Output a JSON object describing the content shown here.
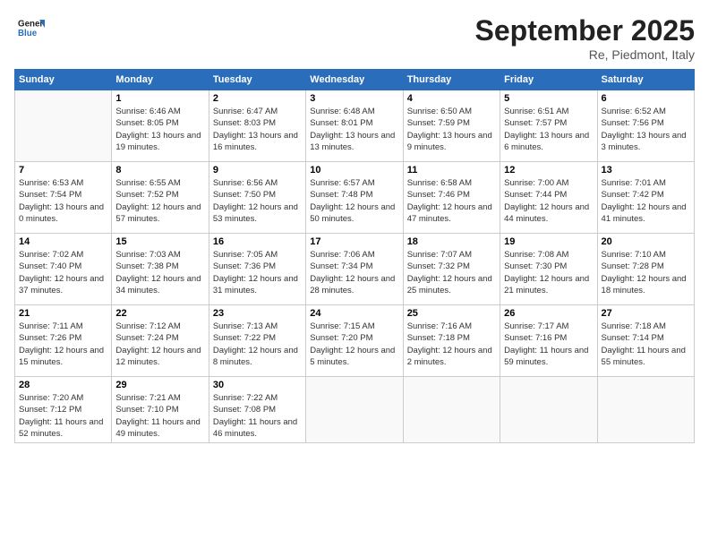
{
  "logo": {
    "line1": "General",
    "line2": "Blue"
  },
  "title": "September 2025",
  "location": "Re, Piedmont, Italy",
  "weekdays": [
    "Sunday",
    "Monday",
    "Tuesday",
    "Wednesday",
    "Thursday",
    "Friday",
    "Saturday"
  ],
  "weeks": [
    [
      {
        "day": "",
        "sunrise": "",
        "sunset": "",
        "daylight": ""
      },
      {
        "day": "1",
        "sunrise": "Sunrise: 6:46 AM",
        "sunset": "Sunset: 8:05 PM",
        "daylight": "Daylight: 13 hours and 19 minutes."
      },
      {
        "day": "2",
        "sunrise": "Sunrise: 6:47 AM",
        "sunset": "Sunset: 8:03 PM",
        "daylight": "Daylight: 13 hours and 16 minutes."
      },
      {
        "day": "3",
        "sunrise": "Sunrise: 6:48 AM",
        "sunset": "Sunset: 8:01 PM",
        "daylight": "Daylight: 13 hours and 13 minutes."
      },
      {
        "day": "4",
        "sunrise": "Sunrise: 6:50 AM",
        "sunset": "Sunset: 7:59 PM",
        "daylight": "Daylight: 13 hours and 9 minutes."
      },
      {
        "day": "5",
        "sunrise": "Sunrise: 6:51 AM",
        "sunset": "Sunset: 7:57 PM",
        "daylight": "Daylight: 13 hours and 6 minutes."
      },
      {
        "day": "6",
        "sunrise": "Sunrise: 6:52 AM",
        "sunset": "Sunset: 7:56 PM",
        "daylight": "Daylight: 13 hours and 3 minutes."
      }
    ],
    [
      {
        "day": "7",
        "sunrise": "Sunrise: 6:53 AM",
        "sunset": "Sunset: 7:54 PM",
        "daylight": "Daylight: 13 hours and 0 minutes."
      },
      {
        "day": "8",
        "sunrise": "Sunrise: 6:55 AM",
        "sunset": "Sunset: 7:52 PM",
        "daylight": "Daylight: 12 hours and 57 minutes."
      },
      {
        "day": "9",
        "sunrise": "Sunrise: 6:56 AM",
        "sunset": "Sunset: 7:50 PM",
        "daylight": "Daylight: 12 hours and 53 minutes."
      },
      {
        "day": "10",
        "sunrise": "Sunrise: 6:57 AM",
        "sunset": "Sunset: 7:48 PM",
        "daylight": "Daylight: 12 hours and 50 minutes."
      },
      {
        "day": "11",
        "sunrise": "Sunrise: 6:58 AM",
        "sunset": "Sunset: 7:46 PM",
        "daylight": "Daylight: 12 hours and 47 minutes."
      },
      {
        "day": "12",
        "sunrise": "Sunrise: 7:00 AM",
        "sunset": "Sunset: 7:44 PM",
        "daylight": "Daylight: 12 hours and 44 minutes."
      },
      {
        "day": "13",
        "sunrise": "Sunrise: 7:01 AM",
        "sunset": "Sunset: 7:42 PM",
        "daylight": "Daylight: 12 hours and 41 minutes."
      }
    ],
    [
      {
        "day": "14",
        "sunrise": "Sunrise: 7:02 AM",
        "sunset": "Sunset: 7:40 PM",
        "daylight": "Daylight: 12 hours and 37 minutes."
      },
      {
        "day": "15",
        "sunrise": "Sunrise: 7:03 AM",
        "sunset": "Sunset: 7:38 PM",
        "daylight": "Daylight: 12 hours and 34 minutes."
      },
      {
        "day": "16",
        "sunrise": "Sunrise: 7:05 AM",
        "sunset": "Sunset: 7:36 PM",
        "daylight": "Daylight: 12 hours and 31 minutes."
      },
      {
        "day": "17",
        "sunrise": "Sunrise: 7:06 AM",
        "sunset": "Sunset: 7:34 PM",
        "daylight": "Daylight: 12 hours and 28 minutes."
      },
      {
        "day": "18",
        "sunrise": "Sunrise: 7:07 AM",
        "sunset": "Sunset: 7:32 PM",
        "daylight": "Daylight: 12 hours and 25 minutes."
      },
      {
        "day": "19",
        "sunrise": "Sunrise: 7:08 AM",
        "sunset": "Sunset: 7:30 PM",
        "daylight": "Daylight: 12 hours and 21 minutes."
      },
      {
        "day": "20",
        "sunrise": "Sunrise: 7:10 AM",
        "sunset": "Sunset: 7:28 PM",
        "daylight": "Daylight: 12 hours and 18 minutes."
      }
    ],
    [
      {
        "day": "21",
        "sunrise": "Sunrise: 7:11 AM",
        "sunset": "Sunset: 7:26 PM",
        "daylight": "Daylight: 12 hours and 15 minutes."
      },
      {
        "day": "22",
        "sunrise": "Sunrise: 7:12 AM",
        "sunset": "Sunset: 7:24 PM",
        "daylight": "Daylight: 12 hours and 12 minutes."
      },
      {
        "day": "23",
        "sunrise": "Sunrise: 7:13 AM",
        "sunset": "Sunset: 7:22 PM",
        "daylight": "Daylight: 12 hours and 8 minutes."
      },
      {
        "day": "24",
        "sunrise": "Sunrise: 7:15 AM",
        "sunset": "Sunset: 7:20 PM",
        "daylight": "Daylight: 12 hours and 5 minutes."
      },
      {
        "day": "25",
        "sunrise": "Sunrise: 7:16 AM",
        "sunset": "Sunset: 7:18 PM",
        "daylight": "Daylight: 12 hours and 2 minutes."
      },
      {
        "day": "26",
        "sunrise": "Sunrise: 7:17 AM",
        "sunset": "Sunset: 7:16 PM",
        "daylight": "Daylight: 11 hours and 59 minutes."
      },
      {
        "day": "27",
        "sunrise": "Sunrise: 7:18 AM",
        "sunset": "Sunset: 7:14 PM",
        "daylight": "Daylight: 11 hours and 55 minutes."
      }
    ],
    [
      {
        "day": "28",
        "sunrise": "Sunrise: 7:20 AM",
        "sunset": "Sunset: 7:12 PM",
        "daylight": "Daylight: 11 hours and 52 minutes."
      },
      {
        "day": "29",
        "sunrise": "Sunrise: 7:21 AM",
        "sunset": "Sunset: 7:10 PM",
        "daylight": "Daylight: 11 hours and 49 minutes."
      },
      {
        "day": "30",
        "sunrise": "Sunrise: 7:22 AM",
        "sunset": "Sunset: 7:08 PM",
        "daylight": "Daylight: 11 hours and 46 minutes."
      },
      {
        "day": "",
        "sunrise": "",
        "sunset": "",
        "daylight": ""
      },
      {
        "day": "",
        "sunrise": "",
        "sunset": "",
        "daylight": ""
      },
      {
        "day": "",
        "sunrise": "",
        "sunset": "",
        "daylight": ""
      },
      {
        "day": "",
        "sunrise": "",
        "sunset": "",
        "daylight": ""
      }
    ]
  ]
}
